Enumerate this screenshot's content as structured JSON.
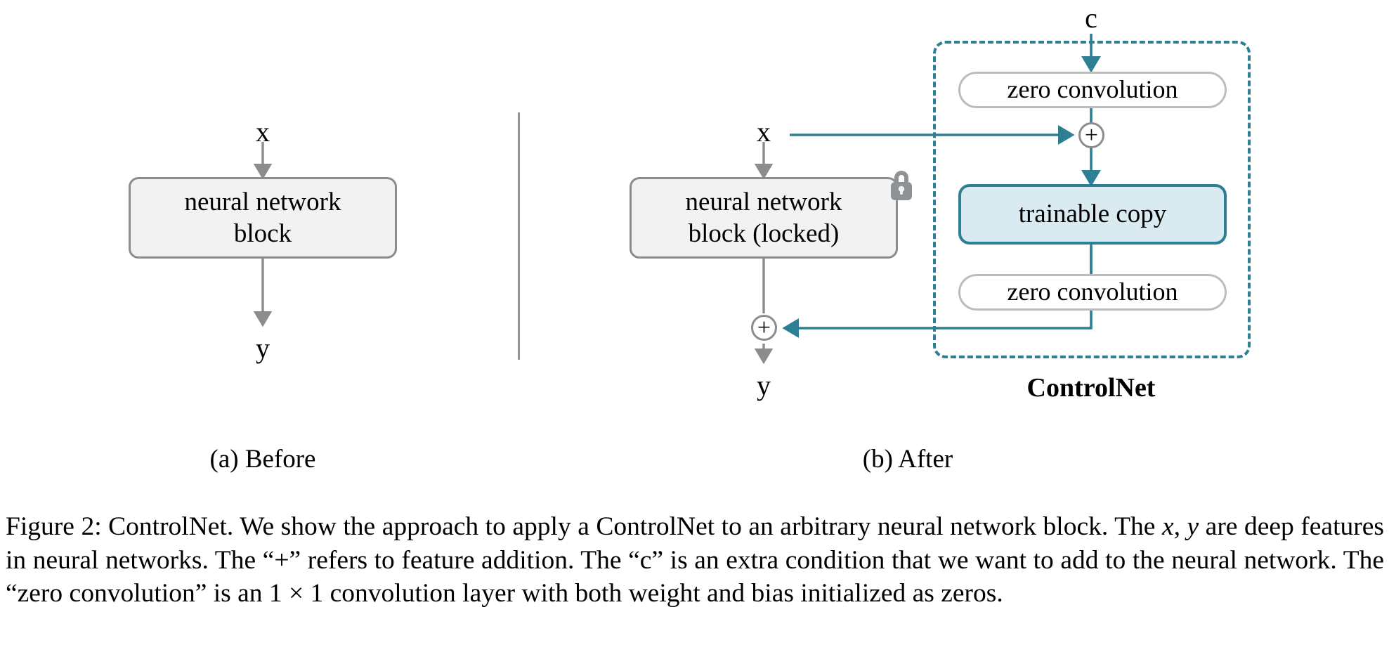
{
  "figure": {
    "number": "Figure 2",
    "title": "ControlNet",
    "caption_segments": {
      "lead": "Figure 2: ControlNet. We show the approach to apply a ControlNet to an arbitrary neural network block. The ",
      "math_xy": "x, y",
      "mid1": " are deep features in neural networks. The “+” refers to feature addition. The “c” is an extra condition that we want to add to the neural network. The “zero convolution” is an ",
      "math_1x1": "1 × 1",
      "tail": " convolution layer with both weight and bias initialized as zeros."
    },
    "caption_full": "Figure 2: ControlNet. We show the approach to apply a ControlNet to an arbitrary neural network block. The x, y are deep features in neural networks. The “+” refers to feature addition. The “c” is an extra condition that we want to add to the neural network. The “zero convolution” is an 1 × 1 convolution layer with both weight and bias initialized as zeros."
  },
  "panels": {
    "before": {
      "sublabel": "(a) Before",
      "input_label": "x",
      "output_label": "y",
      "block_line1": "neural network",
      "block_line2": "block"
    },
    "after": {
      "sublabel": "(b) After",
      "input_label": "x",
      "output_label": "y",
      "condition_label": "c",
      "region_label": "ControlNet",
      "locked_block_line1": "neural network",
      "locked_block_line2": "block (locked)",
      "zero_conv_top": "zero convolution",
      "zero_conv_bottom": "zero convolution",
      "trainable_copy": "trainable copy",
      "plus_top": "+",
      "plus_bottom": "+"
    }
  },
  "icons": {
    "lock": "lock-icon",
    "arrow_down": "arrow-down-icon",
    "arrow_right": "arrow-right-icon",
    "arrow_left": "arrow-left-icon"
  },
  "colors": {
    "accent_teal": "#2e7e94",
    "trainable_fill": "#d9eaf1",
    "block_fill": "#f2f2f2",
    "block_border": "#8c8c8c",
    "pill_border": "#bcbcbc",
    "lock_gray": "#8f9294",
    "divider_gray": "#949494",
    "text": "#000000",
    "page_bg": "#ffffff"
  }
}
